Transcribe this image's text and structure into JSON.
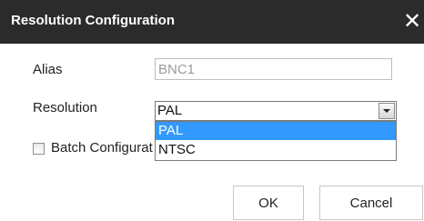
{
  "dialog": {
    "title": "Resolution Configuration",
    "close_glyph": "✕"
  },
  "fields": {
    "alias": {
      "label": "Alias",
      "value": "BNC1"
    },
    "resolution": {
      "label": "Resolution",
      "selected": "PAL",
      "options": [
        "PAL",
        "NTSC"
      ],
      "dropdown_open": true
    }
  },
  "batch": {
    "label": "Batch Configuration",
    "checked": false
  },
  "buttons": {
    "ok": "OK",
    "cancel": "Cancel"
  },
  "colors": {
    "titlebar": "#2b2b2b",
    "highlight": "#3399ff",
    "muted_text": "#9b9b9b"
  },
  "icons": {
    "close": "close-icon",
    "dropdown": "chevron-down-icon"
  }
}
